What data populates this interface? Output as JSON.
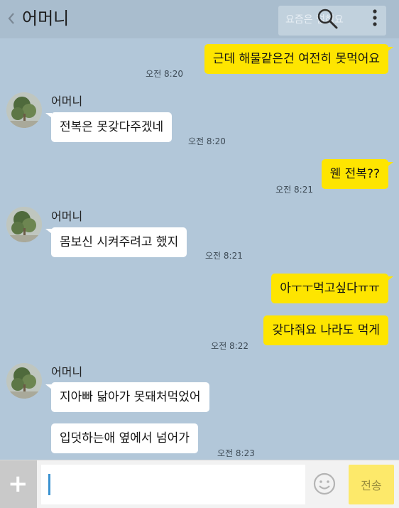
{
  "header": {
    "title": "어머니",
    "search_hint": "요즘은 덜해요",
    "back_icon": "chevron-left-icon",
    "search_icon": "search-icon",
    "more_icon": "more-vertical-icon"
  },
  "colors": {
    "background": "#b2c7d9",
    "my_bubble": "#fee500",
    "other_bubble": "#ffffff",
    "send_button": "#fde96a"
  },
  "messages": [
    {
      "from": "me",
      "text": "근데 해물같은건 여전히 못먹어요",
      "time": "오전 8:20"
    },
    {
      "from": "other",
      "sender": "어머니",
      "text": "전복은 못갖다주겠네",
      "time": "오전 8:20"
    },
    {
      "from": "me",
      "text": "웬 전복??",
      "time": "오전 8:21"
    },
    {
      "from": "other",
      "sender": "어머니",
      "text": "몸보신 시켜주려고 했지",
      "time": "오전 8:21"
    },
    {
      "from": "me",
      "text": "아ㅜㅜ먹고싶다ㅠㅠ",
      "time": ""
    },
    {
      "from": "me",
      "text": "갖다줘요 나라도 먹게",
      "time": "오전 8:22"
    },
    {
      "from": "other",
      "sender": "어머니",
      "text": "지아빠 닮아가 못돼처먹었어",
      "time": ""
    },
    {
      "from": "other",
      "text": "입덧하는애 옆에서 넘어가",
      "time": "오전 8:23"
    }
  ],
  "input": {
    "value": "",
    "plus_label": "+",
    "emoji_icon": "smiley-icon",
    "send_label": "전송"
  }
}
